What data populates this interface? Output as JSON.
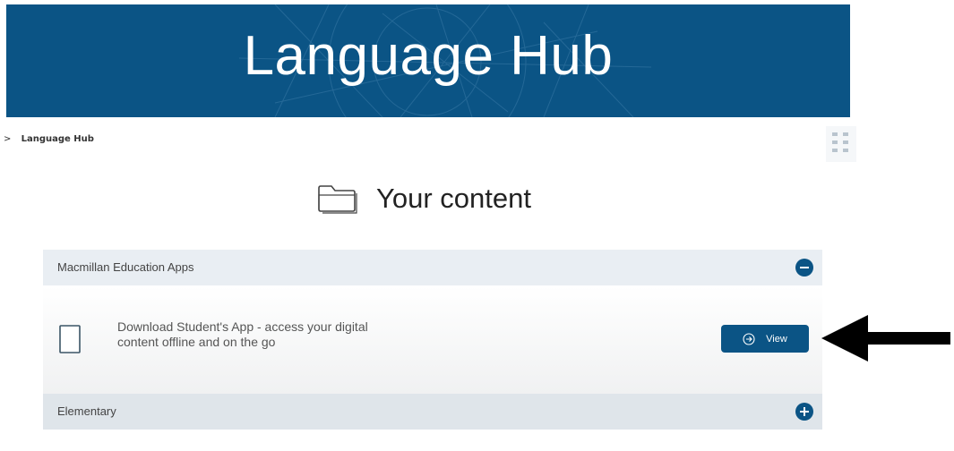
{
  "banner": {
    "title": "Language Hub"
  },
  "breadcrumb": {
    "separator": ">",
    "current": "Language Hub"
  },
  "main": {
    "heading": "Your content",
    "sections": [
      {
        "label": "Macmillan Education Apps",
        "expanded": true,
        "toggle_icon": "minus-circle-icon",
        "items": [
          {
            "icon": "tablet-icon",
            "description_line1": "Download Student's App - access your digital",
            "description_line2": "content offline and on the go",
            "button_label": "View"
          }
        ]
      },
      {
        "label": "Elementary",
        "expanded": false,
        "toggle_icon": "plus-circle-icon"
      }
    ]
  },
  "colors": {
    "brand": "#0b5485",
    "section_bg": "#e9eef3",
    "annotation_arrow": "#000000"
  },
  "icons": [
    "folder-icon",
    "grid-menu-icon",
    "tablet-icon",
    "arrow-right-circle-icon",
    "minus-circle-icon",
    "plus-circle-icon"
  ]
}
